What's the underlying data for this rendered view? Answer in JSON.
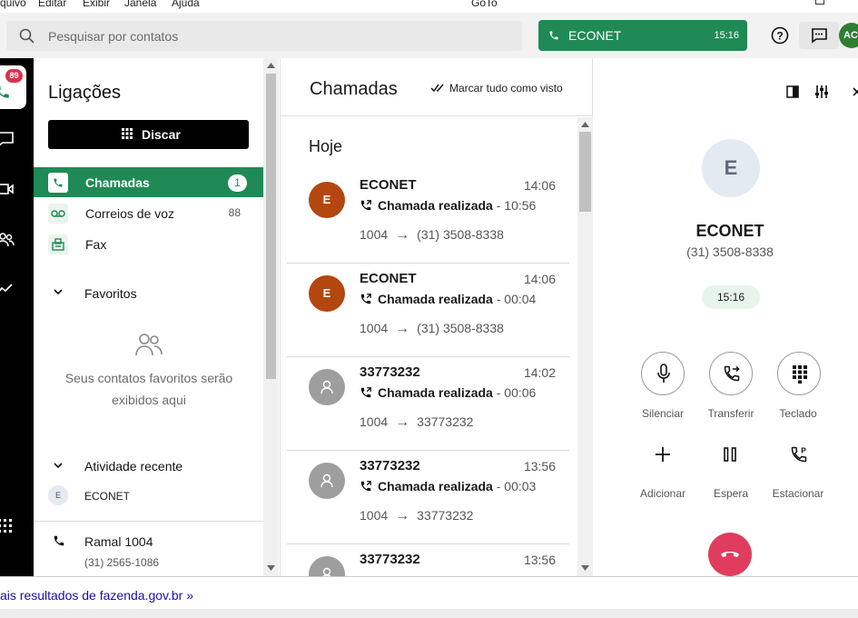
{
  "menubar": {
    "items": [
      "quivo",
      "Editar",
      "Exibir",
      "Janela",
      "Ajuda"
    ],
    "app_title": "GoTo"
  },
  "topbar": {
    "search_placeholder": "Pesquisar por contatos",
    "active_call": {
      "name": "ECONET",
      "time": "15:16"
    },
    "avatar_initials": "AC"
  },
  "rail": {
    "calls_badge": "89"
  },
  "nav": {
    "title": "Ligações",
    "dial_button": "Discar",
    "items": [
      {
        "label": "Chamadas",
        "count": "1"
      },
      {
        "label": "Correios de voz",
        "count": "88"
      },
      {
        "label": "Fax",
        "count": ""
      }
    ],
    "favorites_header": "Favoritos",
    "favorites_empty": "Seus contatos favoritos serão exibidos aqui",
    "recent_header": "Atividade recente",
    "recent": [
      {
        "initial": "E",
        "name": "ECONET"
      }
    ],
    "extension": {
      "name": "Ramal 1004",
      "number": "(31) 2565-1086"
    }
  },
  "calls": {
    "title": "Chamadas",
    "mark_all": "Marcar tudo como visto",
    "group": "Hoje",
    "rows": [
      {
        "initial": "E",
        "name": "ECONET",
        "time": "14:06",
        "status": "Chamada realizada",
        "duration": "- 10:56",
        "from": "1004",
        "to": "(31) 3508-8338",
        "avatar_color": "#b3470f"
      },
      {
        "initial": "E",
        "name": "ECONET",
        "time": "14:06",
        "status": "Chamada realizada",
        "duration": "- 00:04",
        "from": "1004",
        "to": "(31) 3508-8338",
        "avatar_color": "#b3470f"
      },
      {
        "initial": "",
        "name": "33773232",
        "time": "14:02",
        "status": "Chamada realizada",
        "duration": "- 00:06",
        "from": "1004",
        "to": "33773232",
        "avatar_color": "#9e9e9e"
      },
      {
        "initial": "",
        "name": "33773232",
        "time": "13:56",
        "status": "Chamada realizada",
        "duration": "- 00:03",
        "from": "1004",
        "to": "33773232",
        "avatar_color": "#9e9e9e"
      },
      {
        "initial": "",
        "name": "33773232",
        "time": "13:56",
        "status": "",
        "duration": "",
        "from": "",
        "to": "",
        "avatar_color": "#9e9e9e"
      }
    ]
  },
  "detail": {
    "initial": "E",
    "name": "ECONET",
    "number": "(31) 3508-8338",
    "timer": "15:16",
    "controls": [
      "Silenciar",
      "Transferir",
      "Teclado",
      "Adicionar",
      "Espera",
      "Estacionar"
    ]
  },
  "browser": {
    "link": "ais resultados de fazenda.gov.br »"
  },
  "colors": {
    "accent": "#1f8a55",
    "hangup": "#e03d5e",
    "badge": "#d8324f"
  }
}
